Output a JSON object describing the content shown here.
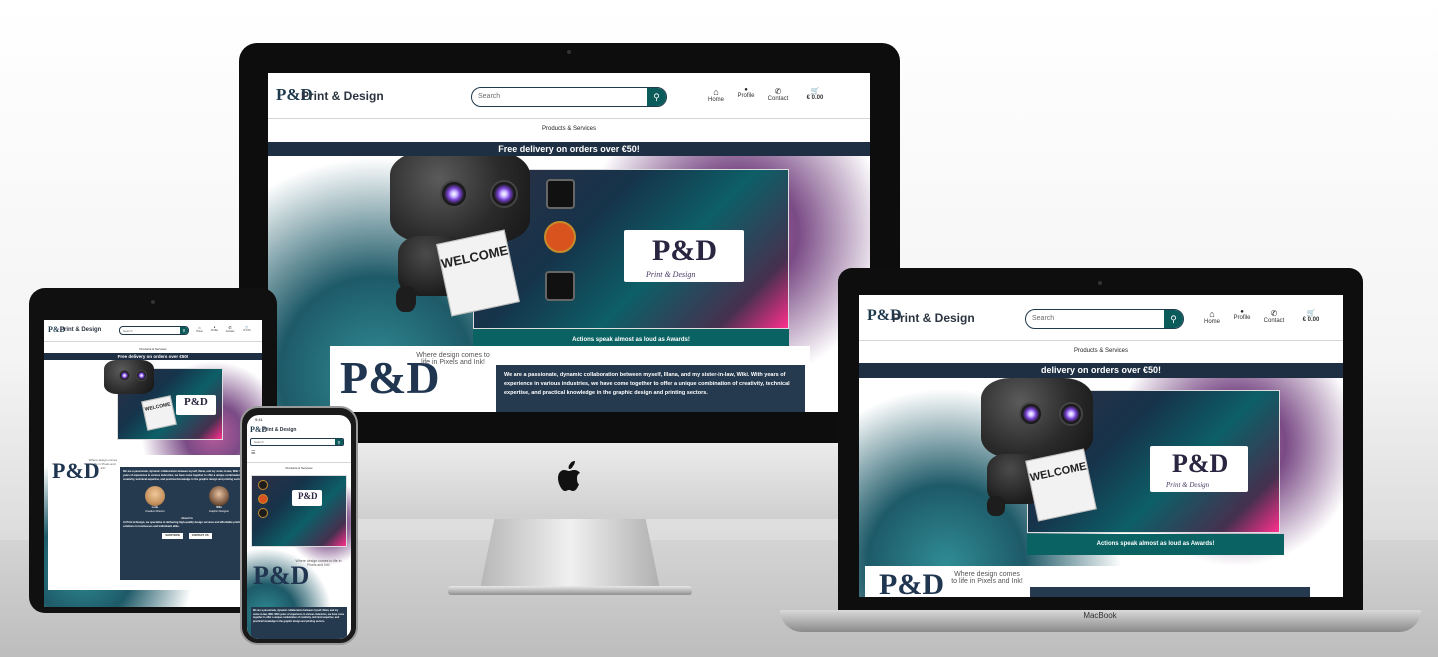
{
  "site": {
    "brand": "Print & Design",
    "logo_mark": "P&D",
    "search_placeholder": "Search",
    "nav": [
      {
        "label": "Home",
        "icon": "home-icon",
        "glyph": "⌂"
      },
      {
        "label": "Profile",
        "icon": "user-icon",
        "glyph": "●"
      },
      {
        "label": "Contact",
        "icon": "phone-icon",
        "glyph": "✆"
      },
      {
        "label": "€ 0.00",
        "icon": "cart-icon",
        "glyph": "🛒"
      }
    ],
    "products_menu": "Products & Services",
    "banner": "Free delivery on orders over €50!",
    "banner_cut": "delivery on orders over €50!",
    "carousel_logo": "P&D",
    "carousel_logo_sub": "Print & Design",
    "carousel_caption": "Actions speak almost as loud as Awards!",
    "robot_paper": "WELCOME",
    "tagline": "Where design comes to life in Pixels and Ink!",
    "about_text": "We are a passionate, dynamic collaboration between myself, Illana, and my sister-in-law, Wiki. With years of experience in various industries, we have come together to offer a unique combination of creativity, technical expertise, and practical knowledge in the graphic design and printing sectors.",
    "team": [
      {
        "name": "Lotte",
        "role": "Creative Director"
      },
      {
        "name": "Wiki",
        "role": "Graphic Designer"
      }
    ],
    "about_us_heading": "About Us",
    "about_us_text": "At Print & Design, we specialise in delivering high-quality design services and affordable printing solutions to businesses and individuals alike.",
    "shop_now": "SHOP NOW",
    "contact_us": "CONTACT US"
  },
  "devices": {
    "laptop_label": "MacBook",
    "phone_time": "9:41"
  },
  "colors": {
    "banner_bg": "#1e2f44",
    "search_btn": "#0b5b5b",
    "caption_bg": "#0b6263",
    "about_bg": "#263a4f"
  }
}
